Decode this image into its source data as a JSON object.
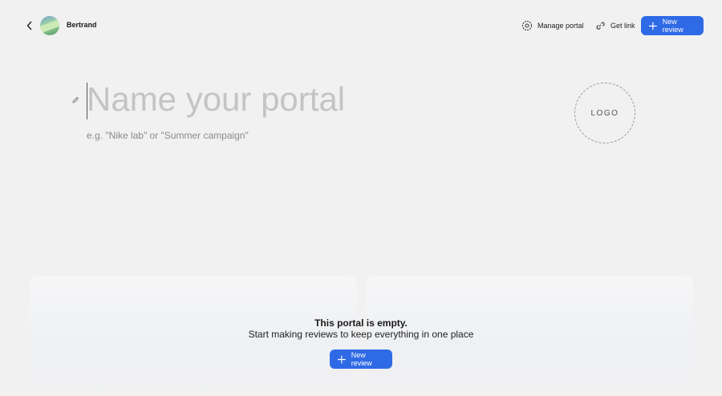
{
  "header": {
    "user_name": "Bertrand",
    "manage_portal": "Manage portal",
    "get_link": "Get link",
    "new_review": "New review"
  },
  "portal": {
    "title_placeholder": "Name your portal",
    "hint": "e.g. \"Nike lab\" or \"Summer campaign\"",
    "logo_label": "LOGO"
  },
  "empty_state": {
    "title": "This portal is empty.",
    "subtitle": "Start making reviews to keep everything in one place",
    "button": "New review"
  },
  "colors": {
    "accent": "#2f6ae6",
    "background": "#f1f1f1"
  }
}
